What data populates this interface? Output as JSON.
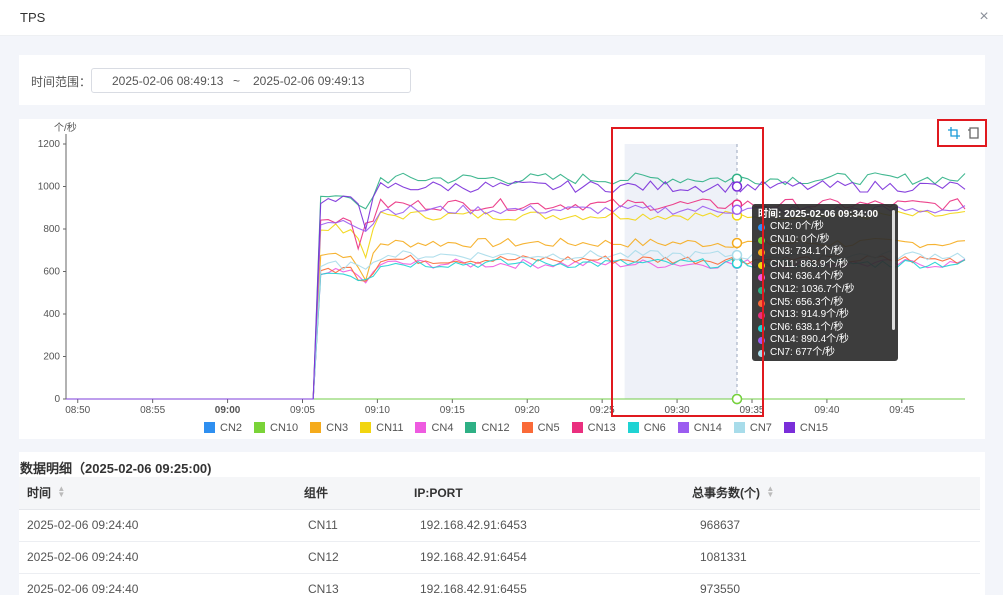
{
  "dialog": {
    "title": "TPS",
    "close_glyph": "×"
  },
  "time_filter": {
    "label": "时间范围：",
    "start": "2025-02-06 08:49:13",
    "separator": "~",
    "end": "2025-02-06 09:49:13"
  },
  "chart_data": {
    "type": "line",
    "ylabel": "个/秒",
    "ylim": [
      0,
      1200
    ],
    "yticks": [
      0,
      200,
      400,
      600,
      800,
      1000,
      1200
    ],
    "xticks": [
      "08:50",
      "08:55",
      "09:00",
      "09:05",
      "09:10",
      "09:15",
      "09:20",
      "09:25",
      "09:30",
      "09:35",
      "09:40",
      "09:45"
    ],
    "x_start": "08:49:13",
    "x_end": "09:49:13",
    "ramp_time": "09:06",
    "grid": false,
    "legend_position": "bottom",
    "brush_range": [
      "09:26:30",
      "09:34:00"
    ],
    "series": [
      {
        "name": "CN2",
        "color": "#2e8ff0",
        "level": 0
      },
      {
        "name": "CN10",
        "color": "#7ad338",
        "level": 0
      },
      {
        "name": "CN3",
        "color": "#f5ab1c",
        "level": 734.1
      },
      {
        "name": "CN11",
        "color": "#f2d50f",
        "level": 863.9
      },
      {
        "name": "CN4",
        "color": "#ee5be0",
        "level": 636.4
      },
      {
        "name": "CN12",
        "color": "#2eb085",
        "level": 1036.7
      },
      {
        "name": "CN5",
        "color": "#fa6a38",
        "level": 656.3
      },
      {
        "name": "CN13",
        "color": "#ea2f7f",
        "level": 914.9
      },
      {
        "name": "CN6",
        "color": "#1fd3d3",
        "level": 638.1
      },
      {
        "name": "CN14",
        "color": "#9b5cf0",
        "level": 890.4
      },
      {
        "name": "CN7",
        "color": "#a8dcea",
        "level": 677
      },
      {
        "name": "CN15",
        "color": "#7a2ed9",
        "level": 1000
      }
    ],
    "tooltip": {
      "time_label": "时间: 2025-02-06 09:34:00",
      "rows": [
        {
          "label": "CN2: 0个/秒",
          "color": "#2e8ff0"
        },
        {
          "label": "CN10: 0个/秒",
          "color": "#7ad338"
        },
        {
          "label": "CN3: 734.1个/秒",
          "color": "#f5ab1c"
        },
        {
          "label": "CN11: 863.9个/秒",
          "color": "#f2d50f"
        },
        {
          "label": "CN4: 636.4个/秒",
          "color": "#ee5be0"
        },
        {
          "label": "CN12: 1036.7个/秒",
          "color": "#2eb085"
        },
        {
          "label": "CN5: 656.3个/秒",
          "color": "#fa6a38"
        },
        {
          "label": "CN13: 914.9个/秒",
          "color": "#ea2f7f"
        },
        {
          "label": "CN6: 638.1个/秒",
          "color": "#1fd3d3"
        },
        {
          "label": "CN14: 890.4个/秒",
          "color": "#9b5cf0"
        },
        {
          "label": "CN7: 677个/秒",
          "color": "#a8dcea"
        }
      ]
    }
  },
  "toolbox": {
    "zoom_icon": "area-zoom-icon",
    "restore_icon": "zoom-restore-icon",
    "accent": "#1a9bd7"
  },
  "detail": {
    "title": "数据明细（2025-02-06 09:25:00)",
    "columns": [
      "时间",
      "组件",
      "IP:PORT",
      "总事务数(个)"
    ],
    "rows": [
      [
        "2025-02-06 09:24:40",
        "CN11",
        "192.168.42.91:6453",
        "968637"
      ],
      [
        "2025-02-06 09:24:40",
        "CN12",
        "192.168.42.91:6454",
        "1081331"
      ],
      [
        "2025-02-06 09:24:40",
        "CN13",
        "192.168.42.91:6455",
        "973550"
      ]
    ]
  }
}
